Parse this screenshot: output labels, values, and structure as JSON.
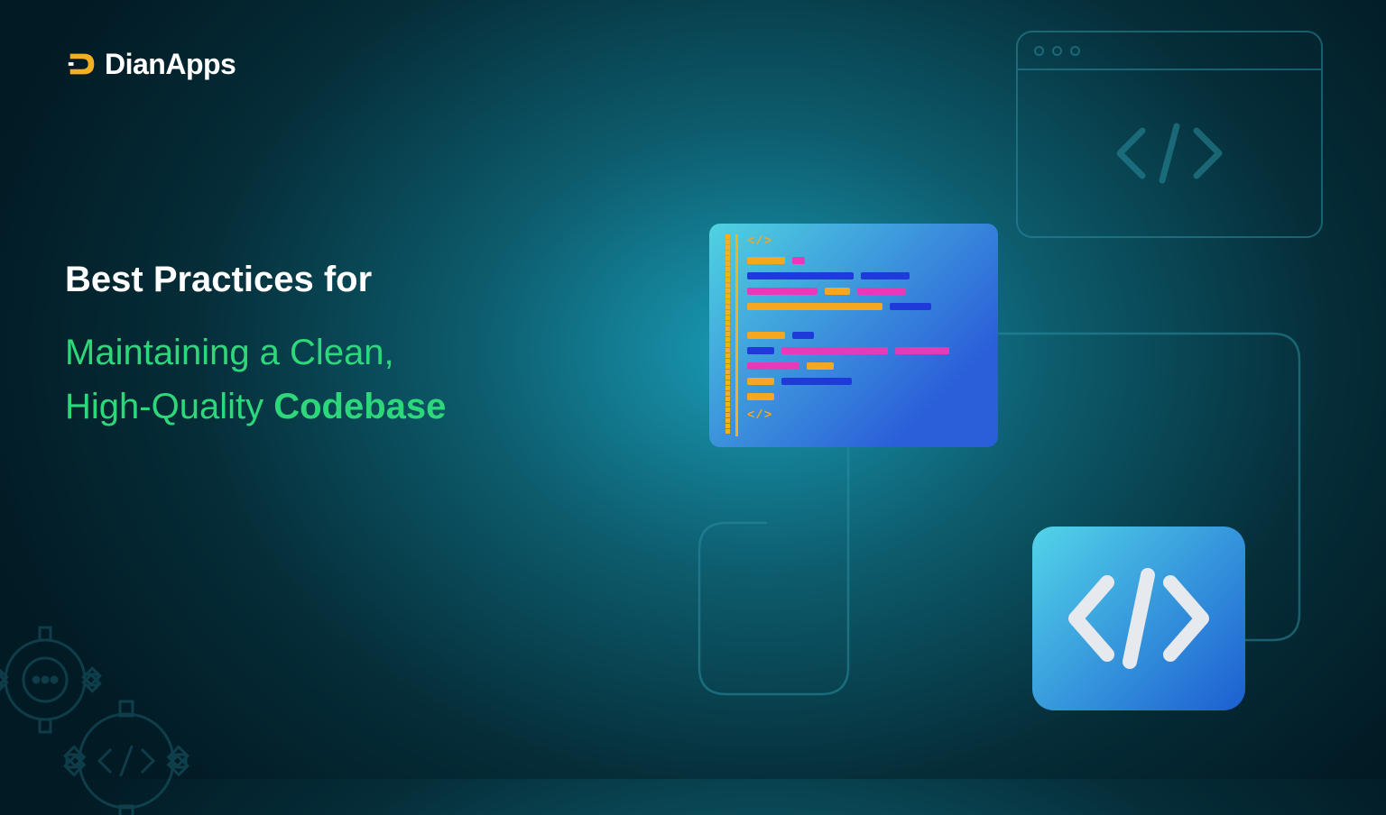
{
  "logo": {
    "brand": "DianApps"
  },
  "heading": {
    "line1": "Best Practices for",
    "line2": "Maintaining a Clean,",
    "line3_prefix": "High-Quality ",
    "line3_bold": "Codebase"
  },
  "icons": {
    "window_tag": "</>"
  },
  "colors": {
    "accent_green": "#2dd87a",
    "accent_orange": "#f5a720",
    "accent_pink": "#e83ab8",
    "accent_blue": "#1e3bd9"
  }
}
